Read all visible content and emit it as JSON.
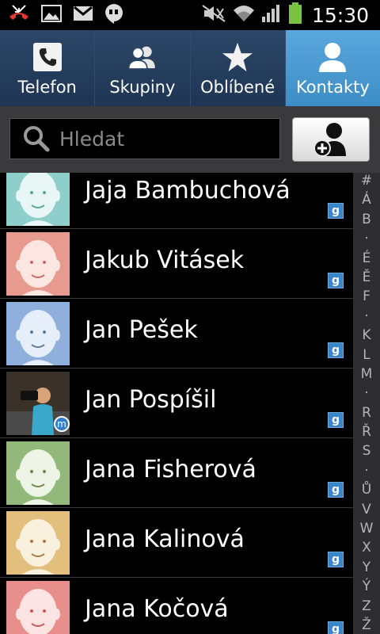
{
  "statusbar": {
    "time": "15:30",
    "left_icons": [
      "missed-call-icon",
      "image-icon",
      "gmail-icon",
      "hangouts-icon"
    ],
    "right_icons": [
      "mute-icon",
      "wifi-icon",
      "signal-icon",
      "battery-icon"
    ]
  },
  "tabs": [
    {
      "label": "Telefon",
      "icon": "phone-icon",
      "active": false
    },
    {
      "label": "Skupiny",
      "icon": "group-icon",
      "active": false
    },
    {
      "label": "Oblíbené",
      "icon": "star-icon",
      "active": false
    },
    {
      "label": "Kontakty",
      "icon": "person-icon",
      "active": true
    }
  ],
  "search": {
    "placeholder": "Hledat"
  },
  "add_contact_icon": "add-contact-icon",
  "contacts": [
    {
      "name": "Jaja Bambuchová",
      "avatar_color": "#8ecfcc",
      "account": "g"
    },
    {
      "name": "Jakub Vitásek",
      "avatar_color": "#e89a8e",
      "account": "g"
    },
    {
      "name": "Jan Pešek",
      "avatar_color": "#8fb0dc",
      "account": "g"
    },
    {
      "name": "Jan Pospíšil",
      "avatar_color": "photo",
      "account": "g"
    },
    {
      "name": "Jana Fisherová",
      "avatar_color": "#92b97a",
      "account": "g"
    },
    {
      "name": "Jana Kalinová",
      "avatar_color": "#e3bf7e",
      "account": "g"
    },
    {
      "name": "Jana Kočová",
      "avatar_color": "#e88f8c",
      "account": "g"
    }
  ],
  "index_letters": [
    "#",
    "Á",
    "B",
    "·",
    "É",
    "Ě",
    "F",
    "·",
    "K",
    "L",
    "M",
    "·",
    "R",
    "Ř",
    "S",
    "·",
    "Ů",
    "V",
    "W",
    "X",
    "Y",
    "Ý",
    "Z",
    "Ž"
  ]
}
